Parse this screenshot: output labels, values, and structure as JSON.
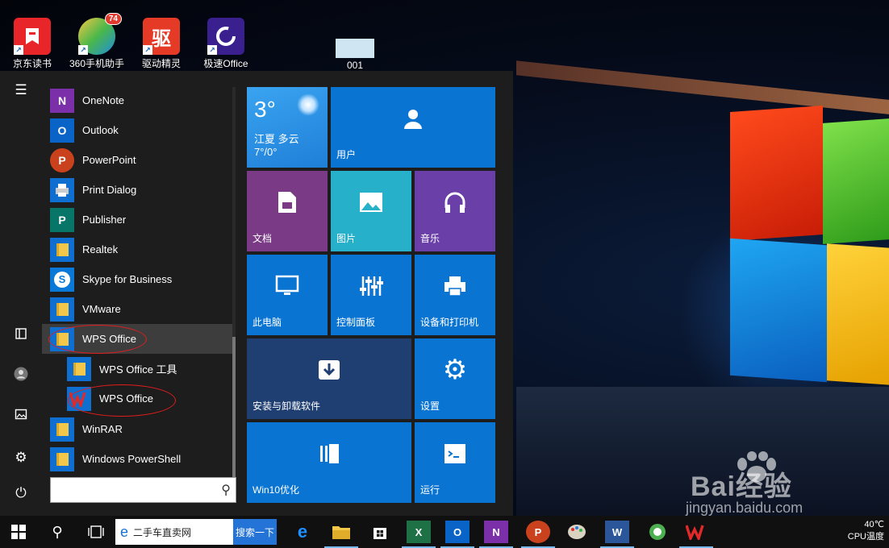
{
  "desktop": {
    "icons": [
      {
        "label": "京东读书",
        "icon": "jd-read-icon",
        "color": "#e8262a"
      },
      {
        "label": "360手机助手",
        "icon": "360-helper-icon",
        "color": "#4ab84a",
        "badge": "74"
      },
      {
        "label": "驱动精灵",
        "icon": "driver-genius-icon",
        "color": "#e53a26",
        "glyph": "驱"
      },
      {
        "label": "极速Office",
        "icon": "speed-office-icon",
        "color": "#3a1f8f"
      },
      {
        "label": "001",
        "icon": "image-file-icon",
        "color": "#cfe6f2"
      }
    ]
  },
  "start_menu": {
    "rail": [
      "hamburger-icon",
      "documents-icon",
      "user-icon",
      "pictures-icon",
      "settings-icon",
      "power-icon"
    ],
    "apps": [
      {
        "label": "OneNote",
        "icon": "onenote-icon",
        "color": "#7b2fa8",
        "glyph": "N"
      },
      {
        "label": "Outlook",
        "icon": "outlook-icon",
        "color": "#0a64c8",
        "glyph": "O"
      },
      {
        "label": "PowerPoint",
        "icon": "powerpoint-icon",
        "color": "#c9421d",
        "glyph": "P"
      },
      {
        "label": "Print Dialog",
        "icon": "printer-icon",
        "color": "#0f6fd0",
        "glyph": "🖨"
      },
      {
        "label": "Publisher",
        "icon": "publisher-icon",
        "color": "#077568",
        "glyph": "P"
      },
      {
        "label": "Realtek",
        "icon": "folder-icon",
        "color": "#0f6fd0"
      },
      {
        "label": "Skype for Business",
        "icon": "skype-icon",
        "color": "#0a78d7",
        "glyph": "S"
      },
      {
        "label": "VMware",
        "icon": "folder-icon",
        "color": "#0f6fd0"
      },
      {
        "label": "WPS Office",
        "icon": "folder-icon",
        "color": "#0f6fd0",
        "selected": true
      },
      {
        "label": "WPS Office 工具",
        "icon": "folder-icon",
        "color": "#0f6fd0",
        "sub": true
      },
      {
        "label": "WPS Office",
        "icon": "wps-icon",
        "color": "#0f6fd0",
        "sub": true
      },
      {
        "label": "WinRAR",
        "icon": "folder-icon",
        "color": "#0f6fd0"
      },
      {
        "label": "Windows PowerShell",
        "icon": "folder-icon",
        "color": "#0f6fd0"
      }
    ],
    "search_placeholder": "",
    "tiles": {
      "weather": {
        "temp": "3°",
        "location": "江夏 多云",
        "range": "7°/0°"
      },
      "user": "用户",
      "documents": "文档",
      "pictures": "图片",
      "music": "音乐",
      "this_pc": "此电脑",
      "control_panel": "控制面板",
      "devices_printers": "设备和打印机",
      "install_uninstall": "安装与卸载软件",
      "settings": "设置",
      "win10_optimize": "Win10优化",
      "run": "运行"
    }
  },
  "taskbar": {
    "search_text": "二手车直卖网",
    "search_button": "搜索一下",
    "apps": [
      "edge-icon",
      "file-explorer-icon",
      "store-icon",
      "excel-icon",
      "outlook-icon",
      "onenote-icon",
      "powerpoint-icon",
      "paint-icon",
      "word-icon",
      "browser-icon",
      "wps-icon"
    ],
    "tray_temp": "40℃",
    "tray_label": "CPU温度"
  },
  "watermark": {
    "text": "Bai经验",
    "url": "jingyan.baidu.com"
  },
  "colors": {
    "tile_blue": "#0a74d2",
    "tile_purple": "#7a3a86",
    "tile_teal": "#26b0c9",
    "tile_violet": "#6b3fa8",
    "tile_navy": "#1f3f73",
    "annotation_red": "#e31d1d"
  }
}
